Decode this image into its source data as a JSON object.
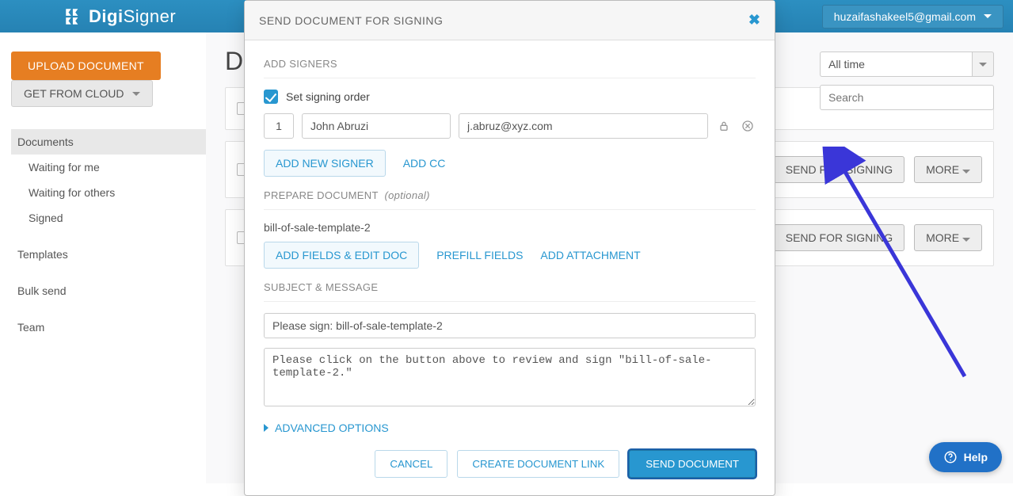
{
  "brand": {
    "part1": "Digi",
    "part2": "Signer"
  },
  "user_email": "huzaifashakeel5@gmail.com",
  "sidebar": {
    "upload": "UPLOAD DOCUMENT",
    "cloud": "GET FROM CLOUD",
    "items": [
      "Documents",
      "Waiting for me",
      "Waiting for others",
      "Signed",
      "Templates",
      "Bulk send",
      "Team"
    ]
  },
  "page_title_visible": "D",
  "filter": {
    "time": "All time",
    "search_placeholder": "Search"
  },
  "row_actions": {
    "send": "SEND FOR SIGNING",
    "more": "MORE"
  },
  "modal": {
    "title": "SEND DOCUMENT FOR SIGNING",
    "sections": {
      "add_signers": "ADD SIGNERS",
      "set_order": "Set signing order",
      "prepare": "PREPARE DOCUMENT",
      "optional": "(optional)",
      "subject": "SUBJECT & MESSAGE",
      "advanced": "ADVANCED OPTIONS"
    },
    "signer": {
      "order": "1",
      "name": "John Abruzi",
      "email": "j.abruz@xyz.com"
    },
    "buttons": {
      "add_signer": "ADD NEW SIGNER",
      "add_cc": "ADD CC",
      "add_fields": "ADD FIELDS & EDIT DOC",
      "prefill": "PREFILL FIELDS",
      "add_attachment": "ADD ATTACHMENT",
      "cancel": "CANCEL",
      "create_link": "CREATE DOCUMENT LINK",
      "send": "SEND DOCUMENT"
    },
    "doc_name": "bill-of-sale-template-2",
    "subject_value": "Please sign: bill-of-sale-template-2",
    "message_value": "Please click on the button above to review and sign \"bill-of-sale-template-2.\""
  },
  "help": "Help"
}
